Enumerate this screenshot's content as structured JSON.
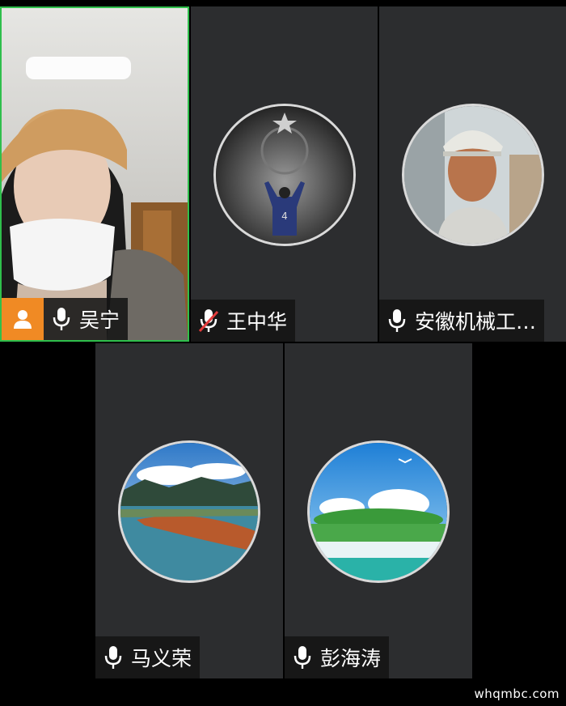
{
  "participants": [
    {
      "name": "吴宁",
      "mic": "on",
      "is_host": true,
      "view": "video"
    },
    {
      "name": "王中华",
      "mic": "muted",
      "is_host": false,
      "view": "avatar"
    },
    {
      "name": "安徽机械工…",
      "mic": "on",
      "is_host": false,
      "view": "avatar"
    },
    {
      "name": "马义荣",
      "mic": "on",
      "is_host": false,
      "view": "avatar"
    },
    {
      "name": "彭海涛",
      "mic": "on",
      "is_host": false,
      "view": "avatar"
    }
  ],
  "watermark": "whqmbc.com",
  "colors": {
    "host_badge": "#f08a24",
    "active_speaker_border": "#2fbf4c",
    "tile_bg": "#2c2d2f",
    "muted_slash": "#e23b3b"
  }
}
